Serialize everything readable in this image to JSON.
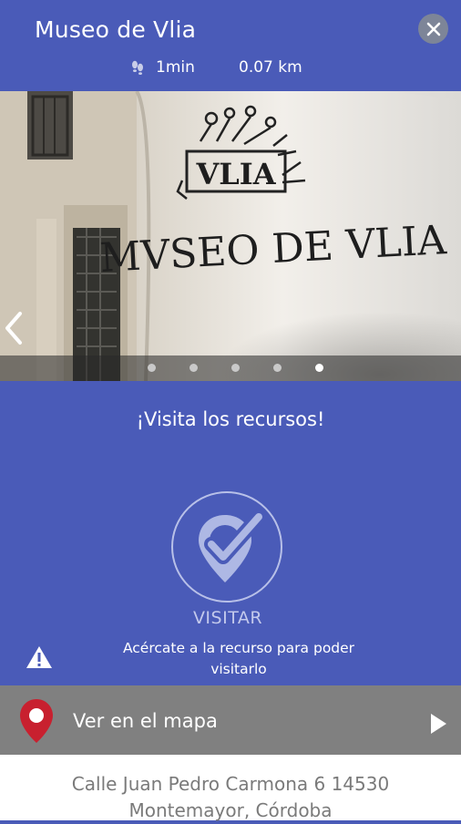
{
  "header": {
    "title": "Museo de Vlia",
    "time": "1min",
    "distance": "0.07 km",
    "icons": {
      "walk": "footsteps-icon",
      "close": "close-icon"
    }
  },
  "gallery": {
    "sign_logo": "VLIA",
    "sign_text": "MVSEO DE VLIA",
    "slide_count": 5,
    "active_slide": 5,
    "icons": {
      "prev": "chevron-left-icon"
    }
  },
  "visit": {
    "invite": "¡Visita los recursos!",
    "button_label": "VISITAR",
    "hint_line1": "Acércate a la recurso para poder",
    "hint_line2": "visitarlo",
    "icons": {
      "visit": "location-check-icon",
      "warning": "warning-icon"
    }
  },
  "map": {
    "label": "Ver en el mapa",
    "icons": {
      "pin": "map-pin-icon",
      "go": "play-arrow-icon"
    }
  },
  "address": {
    "line1": "Calle Juan Pedro Carmona 6 14530",
    "line2": "Montemayor, Córdoba"
  },
  "colors": {
    "primary": "#4a5bb8",
    "map_bar": "#808080",
    "pin": "#c8202f",
    "address_text": "#7a7a7a"
  }
}
